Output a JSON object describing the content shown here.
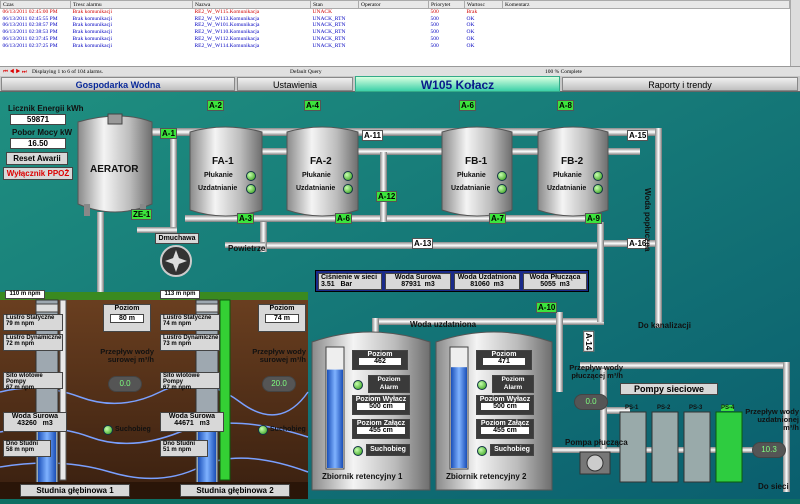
{
  "alarm_panel": {
    "columns": [
      "Czas",
      "Tresc alarmu",
      "Nazwa",
      "Stan",
      "Operator",
      "Priorytet",
      "Wartosc",
      "Komentarz"
    ],
    "rows": [
      {
        "time": "06/13/2011 02:45:00 PM",
        "text": "Brak komunikacji",
        "name": "RE2_W_W115.Komunikacja",
        "state": "UNACK",
        "operator": "",
        "priority": "500",
        "value": "Brak",
        "color": "red"
      },
      {
        "time": "06/13/2011 02:45:55 PM",
        "text": "Brak komunikacji",
        "name": "RE2_W_W113.Komunikacja",
        "state": "UNACK_RTN",
        "operator": "",
        "priority": "500",
        "value": "OK",
        "color": "blue"
      },
      {
        "time": "06/13/2011 02:38:57 PM",
        "text": "Brak komunikacji",
        "name": "RE2_W_W101.Komunikacja",
        "state": "UNACK_RTN",
        "operator": "",
        "priority": "500",
        "value": "OK",
        "color": "blue"
      },
      {
        "time": "06/13/2011 02:38:53 PM",
        "text": "Brak komunikacji",
        "name": "RE2_W_W110.Komunikacja",
        "state": "UNACK_RTN",
        "operator": "",
        "priority": "500",
        "value": "OK",
        "color": "blue"
      },
      {
        "time": "06/13/2011 02:37:45 PM",
        "text": "Brak komunikacji",
        "name": "RE2_W_W112.Komunikacja",
        "state": "UNACK_RTN",
        "operator": "",
        "priority": "500",
        "value": "OK",
        "color": "blue"
      },
      {
        "time": "06/13/2011 02:37:25 PM",
        "text": "Brak komunikacji",
        "name": "RE2_W_W114.Komunikacja",
        "state": "UNACK_RTN",
        "operator": "",
        "priority": "500",
        "value": "OK",
        "color": "blue"
      }
    ],
    "status_left": "Displaying 1 to 6 of 104 alarms.",
    "status_mid": "Default Query",
    "status_right": "100 % Complete"
  },
  "nav": {
    "tab1": "Gospodarka Wodna",
    "tab2": "Ustawienia",
    "title": "W105 Kołacz",
    "tab3": "Raporty i trendy"
  },
  "left_panel": {
    "energy_label": "Licznik Energii kWh",
    "energy_value": "59871",
    "power_label": "Pobor Mocy kW",
    "power_value": "16.50",
    "reset_label": "Reset Awarii",
    "ppoz_label": "Wyłącznik PPOŻ"
  },
  "aerator": {
    "label": "AERATOR"
  },
  "filters": [
    {
      "name": "FA-1",
      "l1": "Płukanie",
      "l2": "Uzdatnianie"
    },
    {
      "name": "FA-2",
      "l1": "Płukanie",
      "l2": "Uzdatnianie"
    },
    {
      "name": "FB-1",
      "l1": "Płukanie",
      "l2": "Uzdatnianie"
    },
    {
      "name": "FB-2",
      "l1": "Płukanie",
      "l2": "Uzdatnianie"
    }
  ],
  "valves": {
    "a1": "A-1",
    "a2": "A-2",
    "a3": "A-3",
    "a4": "A-4",
    "a5": "A-5",
    "a6": "A-6",
    "a7": "A-7",
    "a8": "A-8",
    "a9": "A-9",
    "a10": "A-10",
    "a11": "A-11",
    "a12": "A-12",
    "a13": "A-13",
    "a14": "A-14",
    "a15": "A-15",
    "a16": "A-16",
    "ze1": "ZE-1"
  },
  "labels": {
    "dmuchawa": "Dmuchawa",
    "powietrze": "Powietrze",
    "woda_poplucz": "Woda popłuczna",
    "do_kanalizacji": "Do kanalizacji",
    "woda_uzdatniona": "Woda uzdatniona",
    "pompy_sieciowe": "Pompy sieciowe",
    "pompa_pluczaca": "Pompa płucząca",
    "do_sieci": "Do sieci",
    "przeplyw_pluczacej": "Przepływ wody płuczącej m³/h",
    "przeplyw_uzdatnionej": "Przepływ wody uzdatnionej m³/h"
  },
  "summary": [
    {
      "label": "Ciśnienie w sieci",
      "value": "3.51",
      "unit": "Bar"
    },
    {
      "label": "Woda Surowa",
      "value": "87931",
      "unit": "m3"
    },
    {
      "label": "Woda Uzdatniona",
      "value": "81060",
      "unit": "m3"
    },
    {
      "label": "Woda Płucząca",
      "value": "5055",
      "unit": "m3"
    }
  ],
  "wells": [
    {
      "name": "Studnia głębinowa 1",
      "depth_top": "110",
      "depth_unit": "m npm",
      "luster_stat_label": "Lustro Statyczne",
      "luster_stat": "79",
      "luster_dyn_label": "Lustro Dynamiczne",
      "luster_dyn": "72",
      "sito_label": "Sito wlotowe Pompy",
      "sito": "67",
      "unit": "m npm",
      "poziom_label": "Poziom",
      "poziom": "80",
      "flow_label": "Przepływ wody surowej m³/h",
      "flow": "0.0",
      "woda_label": "Woda Surowa",
      "woda": "43260",
      "woda_unit": "m3",
      "dno_label": "Dno Studni",
      "dno": "58",
      "suchobieg": "Suchobieg"
    },
    {
      "name": "Studnia głębinowa 2",
      "depth_top": "113",
      "depth_unit": "m npm",
      "luster_stat_label": "Lustro Statyczne",
      "luster_stat": "74",
      "luster_dyn_label": "Lustro Dynamiczne",
      "luster_dyn": "73",
      "sito_label": "Sito wlotowe Pompy",
      "sito": "67",
      "unit": "m npm",
      "poziom_label": "Poziom",
      "poziom": "74",
      "flow_label": "Przepływ wody surowej m³/h",
      "flow": "20.0",
      "woda_label": "Woda Surowa",
      "woda": "44671",
      "woda_unit": "m3",
      "dno_label": "Dno Studni",
      "dno": "51",
      "suchobieg": "Suchobieg"
    }
  ],
  "tanks": [
    {
      "name": "Zbiornik retencyjny 1",
      "poziom_label": "Poziom",
      "poziom": "462",
      "alarm_label": "Poziom Alarm",
      "wyl_label": "Poziom Wyłacz",
      "wyl": "500",
      "zal_label": "Poziom Załącz",
      "zal": "455",
      "unit": "cm",
      "suchobieg": "Suchobieg",
      "fill": 0.82
    },
    {
      "name": "Zbiornik retencyjny 2",
      "poziom_label": "Poziom",
      "poziom": "471",
      "alarm_label": "Poziom Alarm",
      "wyl_label": "Poziom Wyłacz",
      "wyl": "500",
      "zal_label": "Poziom Załącz",
      "zal": "455",
      "unit": "cm",
      "suchobieg": "Suchobieg",
      "fill": 0.84
    }
  ],
  "pumps": [
    "PS-1",
    "PS-2",
    "PS-3",
    "PS-4"
  ],
  "meters": {
    "pluczaca": "0.0",
    "uzdatniona": "10.3"
  }
}
